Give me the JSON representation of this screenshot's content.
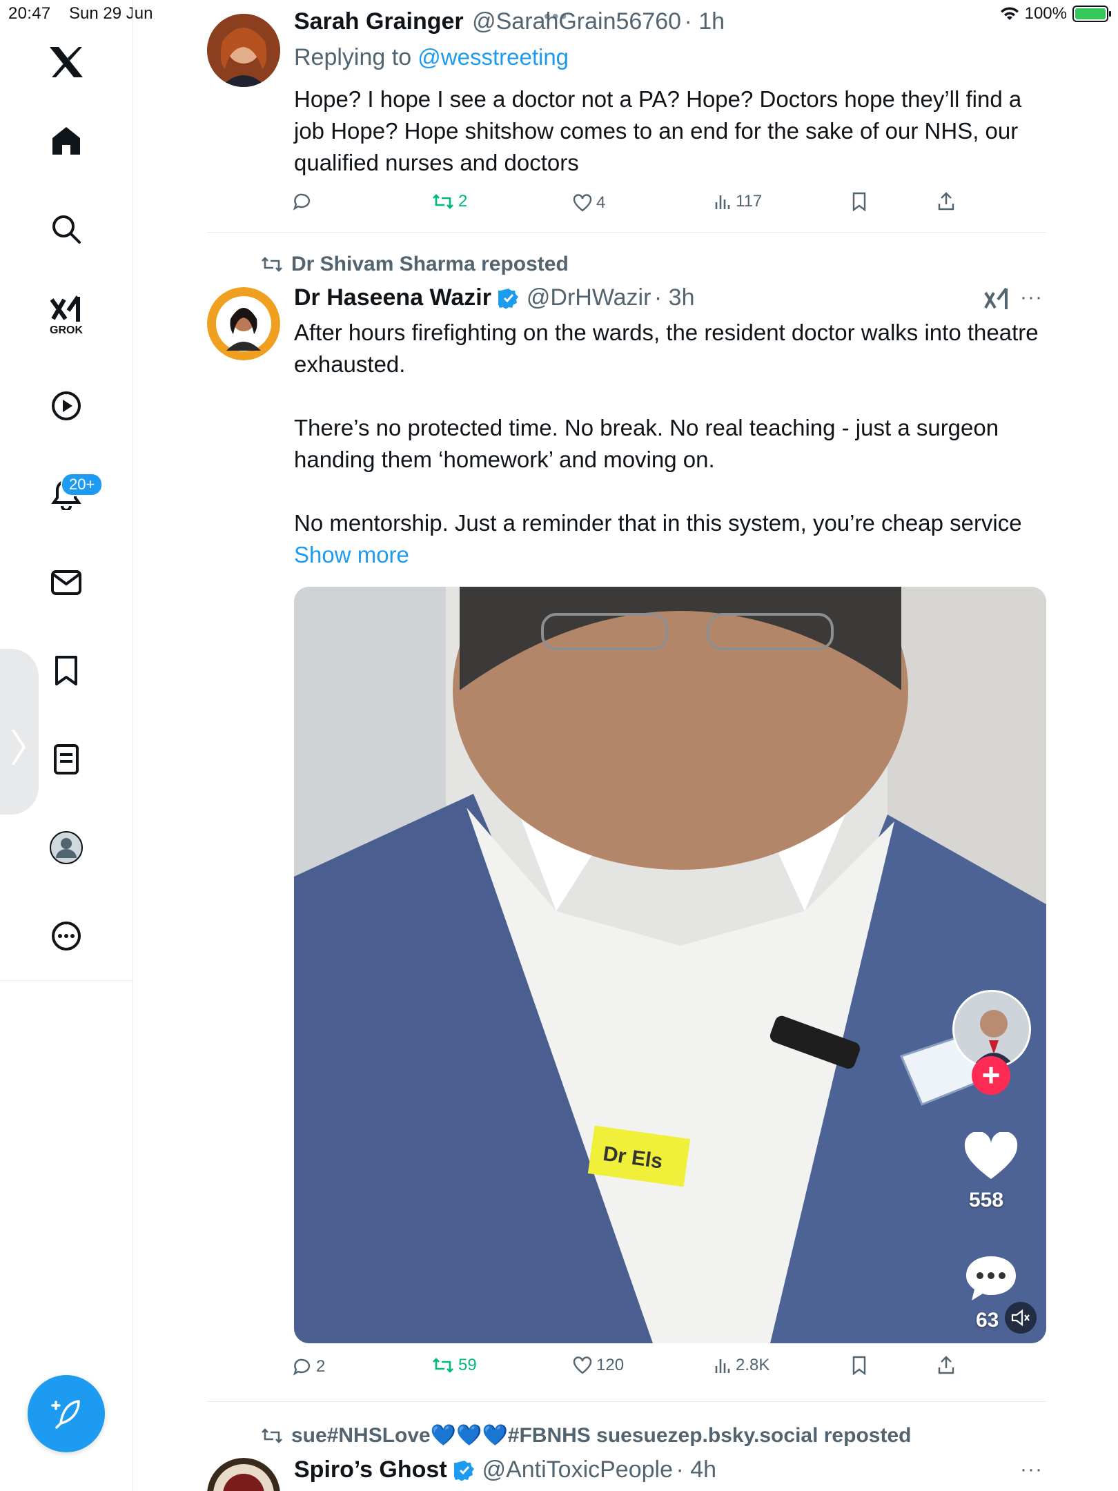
{
  "status_bar": {
    "time": "20:47",
    "date": "Sun 29 Jun",
    "battery": "100%",
    "battery_level": 1.0
  },
  "sidebar": {
    "grok_label": "GROK",
    "notifications_badge": "20+",
    "items": [
      "x-logo-icon",
      "home-icon",
      "search-icon",
      "grok-icon",
      "video-icon",
      "notifications-icon",
      "messages-icon",
      "bookmarks-icon",
      "lists-icon",
      "profile-icon",
      "more-icon"
    ]
  },
  "posts": [
    {
      "name": "Sarah Grainger",
      "handle": "@SarahGrain56760",
      "time": "· 1h",
      "replying_prefix": "Replying to",
      "replying_to": "@wesstreeting",
      "text": "Hope? I hope I see a doctor not a PA? Hope? Doctors hope they’ll find a job Hope? Hope shitshow comes to an end for the sake of our NHS, our qualified nurses and doctors",
      "replies": "",
      "reposts": "2",
      "likes": "4",
      "views": "117"
    },
    {
      "reposted_by": "Dr Shivam Sharma reposted",
      "name": "Dr Haseena Wazir",
      "handle": "@DrHWazir",
      "time": "· 3h",
      "paragraphs": [
        "After hours firefighting on the wards, the resident doctor walks into theatre exhausted.",
        "There’s no protected time. No break. No real teaching - just a surgeon handing them ‘homework’ and moving on.",
        "No mentorship. Just a reminder that in this system, you’re cheap service"
      ],
      "show_more": "Show more",
      "video": {
        "name_tag": "Dr Els",
        "likes": "558",
        "comments": "63"
      },
      "replies": "2",
      "reposts": "59",
      "likes": "120",
      "views": "2.8K"
    },
    {
      "reposted_by": "sue#NHSLove💙💙💙#FBNHS suesuezep.bsky.social reposted",
      "name": "Spiro’s Ghost",
      "handle": "@AntiToxicPeople",
      "time": "· 4h"
    }
  ],
  "colors": {
    "accent": "#1d9bf0",
    "repost_green": "#00ba7c",
    "text": "#0f1419",
    "muted": "#536471"
  }
}
